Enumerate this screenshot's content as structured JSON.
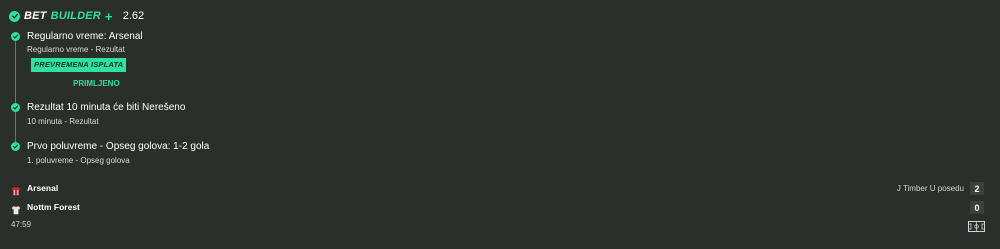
{
  "header": {
    "title_word1": "BET",
    "title_word2": "BUILDER",
    "plus": "+",
    "odds": "2.62"
  },
  "legs": [
    {
      "title": "Regularno vreme: Arsenal",
      "subtitle": "Regularno vreme - Rezultat",
      "badge": "PREVREMENA ISPLATA",
      "status": "PRIMLJENO"
    },
    {
      "title": "Rezultat 10 minuta će biti Nerešeno",
      "subtitle": "10 minuta - Rezultat"
    },
    {
      "title": "Prvo poluvreme - Opseg golova: 1-2 gola",
      "subtitle": "1. poluvreme - Opseg golova"
    }
  ],
  "match": {
    "home": {
      "name": "Arsenal",
      "score": "2",
      "shirt_color": "#d8202a"
    },
    "away": {
      "name": "Nottm Forest",
      "score": "0",
      "shirt_color": "#e6e6e6"
    },
    "status": "J Timber U posedu",
    "clock": "47:59"
  },
  "colors": {
    "accent": "#2ee0a2",
    "background": "#2b2f2c"
  },
  "icons": {
    "header_check": "check-icon",
    "leg_check": "check-icon",
    "home_shirt": "shirt-icon",
    "away_shirt": "shirt-icon",
    "pitch": "pitch-icon"
  }
}
